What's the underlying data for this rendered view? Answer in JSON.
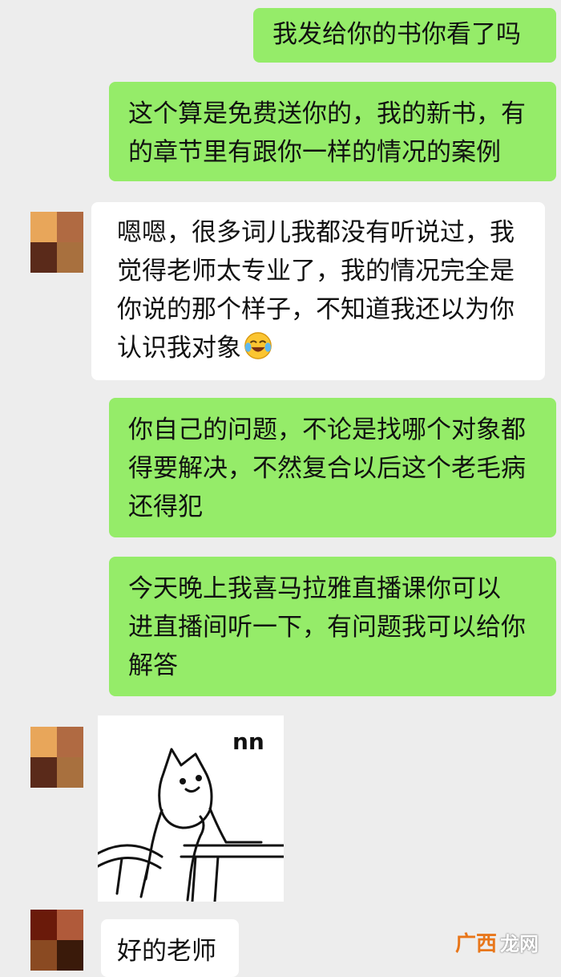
{
  "messages": [
    {
      "side": "out",
      "lines": [
        "我发给你的书你看了吗"
      ]
    },
    {
      "side": "out",
      "lines": [
        "这个算是免费送你的，我的新书，有",
        "的章节里有跟你一样的情况的案例"
      ]
    },
    {
      "side": "in",
      "lines": [
        "嗯嗯，很多词儿我都没有听说过，我",
        "觉得老师太专业了，我的情况完全是",
        "你说的那个样子，不知道我还以为你",
        "认识我对象"
      ],
      "emoji": "laughing-crying-emoji"
    },
    {
      "side": "out",
      "lines": [
        "你自己的问题，不论是找哪个对象都",
        "得要解决，不然复合以后这个老毛病",
        "还得犯"
      ]
    },
    {
      "side": "out",
      "lines": [
        "今天晚上我喜马拉雅直播课你可以",
        "进直播间听一下，有问题我可以给你",
        "解答"
      ]
    },
    {
      "side": "in",
      "type": "sticker",
      "sticker_text": "nn",
      "icon": "cat-sticker"
    },
    {
      "side": "in",
      "lines": [
        "好的老师"
      ]
    }
  ],
  "colors": {
    "background": "#ededed",
    "outgoing_bubble": "#95ec69",
    "incoming_bubble": "#ffffff",
    "watermark_logo": "#e8761a"
  },
  "watermark": {
    "logo_text": "广西",
    "text": "龙网"
  }
}
